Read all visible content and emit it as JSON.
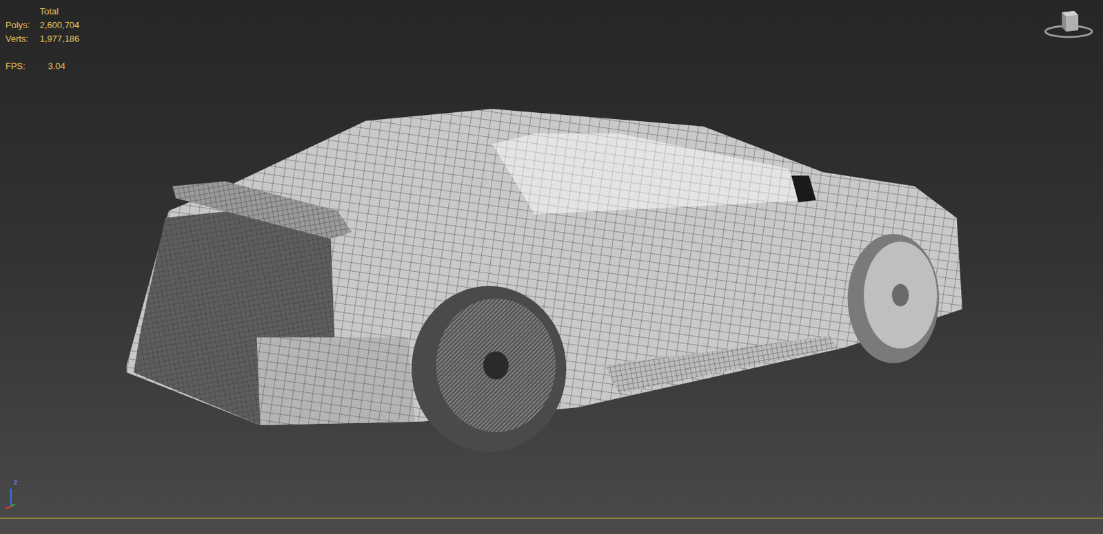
{
  "viewport": {
    "active": true,
    "stats": {
      "title": "Total",
      "rows": [
        {
          "label": "Polys:",
          "value": "2,600,704"
        },
        {
          "label": "Verts:",
          "value": "1,977,186"
        }
      ]
    },
    "fps": {
      "label": "FPS:",
      "value": "3.04"
    },
    "axis_label": "z"
  }
}
